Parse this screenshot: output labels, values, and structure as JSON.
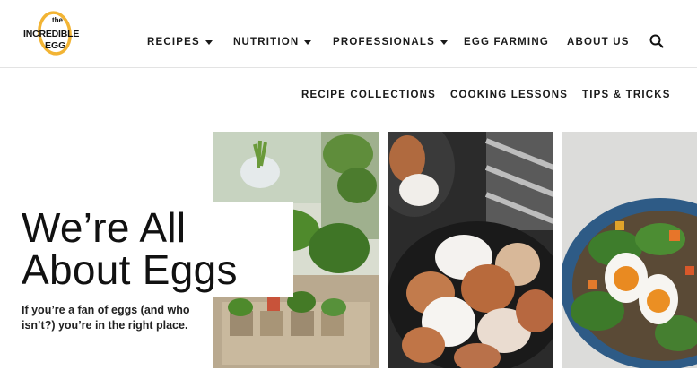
{
  "logo": {
    "line1": "the",
    "line2": "INCREDIBLE",
    "line3": "EGG",
    "ring_color": "#f2b434"
  },
  "nav": {
    "items": [
      {
        "label": "RECIPES",
        "has_dropdown": true
      },
      {
        "label": "NUTRITION",
        "has_dropdown": true
      },
      {
        "label": "PROFESSIONALS",
        "has_dropdown": true
      },
      {
        "label": "EGG FARMING",
        "has_dropdown": false
      },
      {
        "label": "ABOUT US",
        "has_dropdown": false
      }
    ],
    "search_icon": "search-icon"
  },
  "subnav": {
    "items": [
      {
        "label": "RECIPE COLLECTIONS"
      },
      {
        "label": "COOKING LESSONS"
      },
      {
        "label": "TIPS & TRICKS"
      }
    ]
  },
  "hero": {
    "title_line1": "We’re All",
    "title_line2": "About Eggs",
    "text": "If you’re a fan of eggs (and who isn’t?) you’re in the right place."
  },
  "colors": {
    "accent": "#f2b434",
    "text": "#111111"
  }
}
